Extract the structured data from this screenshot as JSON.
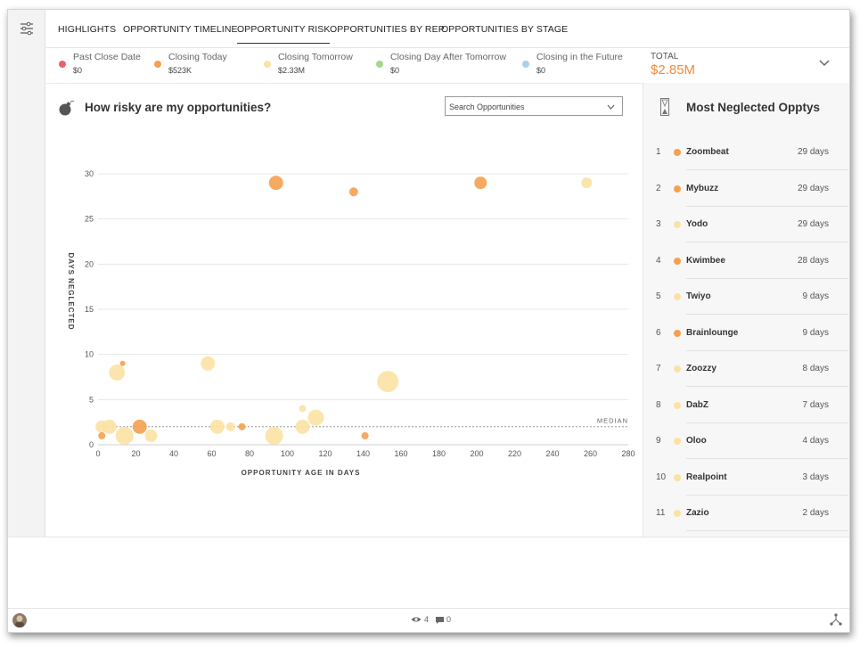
{
  "tabs": [
    "HIGHLIGHTS",
    "OPPORTUNITY TIMELINE",
    "OPPORTUNITY RISK",
    "OPPORTUNITIES BY REP",
    "OPPORTUNITIES BY STAGE"
  ],
  "active_tab": "OPPORTUNITY RISK",
  "legend": [
    {
      "label": "Past Close Date",
      "value": "$0",
      "color": "#e8626b"
    },
    {
      "label": "Closing Today",
      "value": "$523K",
      "color": "#f5a04f"
    },
    {
      "label": "Closing Tomorrow",
      "value": "$2.33M",
      "color": "#fbe2a4"
    },
    {
      "label": "Closing Day After Tomorrow",
      "value": "$0",
      "color": "#a4d88d"
    },
    {
      "label": "Closing in the Future",
      "value": "$0",
      "color": "#a8d0ef"
    }
  ],
  "total": {
    "label": "TOTAL",
    "value": "$2.85M"
  },
  "chart_title": "How risky are my opportunities?",
  "search": {
    "placeholder": "Search Opportunities"
  },
  "chart_data": {
    "type": "scatter",
    "xlabel": "OPPORTUNITY AGE IN DAYS",
    "ylabel": "DAYS NEGLECTED",
    "xlim": [
      0,
      280
    ],
    "ylim": [
      0,
      30
    ],
    "xticks": [
      "0",
      "20",
      "40",
      "60",
      "80",
      "100",
      "120",
      "140",
      "160",
      "180",
      "200",
      "220",
      "240",
      "260",
      "280"
    ],
    "yticks": [
      "0",
      "5",
      "10",
      "15",
      "20",
      "25",
      "30"
    ],
    "median": {
      "label": "MEDIAN",
      "y": 2
    },
    "grid": "horizontal",
    "points": [
      {
        "x": 94,
        "y": 29,
        "r": 8,
        "color": "#f5a04f"
      },
      {
        "x": 135,
        "y": 28,
        "r": 5,
        "color": "#f5a04f"
      },
      {
        "x": 202,
        "y": 29,
        "r": 7,
        "color": "#f5a04f"
      },
      {
        "x": 258,
        "y": 29,
        "r": 6,
        "color": "#fbe2a4"
      },
      {
        "x": 13,
        "y": 9,
        "r": 3,
        "color": "#f5a04f"
      },
      {
        "x": 10,
        "y": 8,
        "r": 9,
        "color": "#fbe2a4"
      },
      {
        "x": 58,
        "y": 9,
        "r": 8,
        "color": "#fbe2a4"
      },
      {
        "x": 153,
        "y": 7,
        "r": 12,
        "color": "#fbe2a4"
      },
      {
        "x": 2,
        "y": 2,
        "r": 7,
        "color": "#fbe2a4"
      },
      {
        "x": 6,
        "y": 2,
        "r": 8,
        "color": "#fbe2a4"
      },
      {
        "x": 2,
        "y": 1,
        "r": 4,
        "color": "#f5a04f"
      },
      {
        "x": 14,
        "y": 1,
        "r": 10,
        "color": "#fbe2a4"
      },
      {
        "x": 22,
        "y": 2,
        "r": 8,
        "color": "#f5a04f"
      },
      {
        "x": 28,
        "y": 1,
        "r": 7,
        "color": "#fbe2a4"
      },
      {
        "x": 63,
        "y": 2,
        "r": 8,
        "color": "#fbe2a4"
      },
      {
        "x": 70,
        "y": 2,
        "r": 5,
        "color": "#fbe2a4"
      },
      {
        "x": 76,
        "y": 2,
        "r": 4,
        "color": "#f5a04f"
      },
      {
        "x": 93,
        "y": 1,
        "r": 10,
        "color": "#fbe2a4"
      },
      {
        "x": 108,
        "y": 4,
        "r": 4,
        "color": "#fbe2a4"
      },
      {
        "x": 108,
        "y": 2,
        "r": 8,
        "color": "#fbe2a4"
      },
      {
        "x": 115,
        "y": 3,
        "r": 9,
        "color": "#fbe2a4"
      },
      {
        "x": 141,
        "y": 1,
        "r": 4,
        "color": "#f5a04f"
      }
    ]
  },
  "side": {
    "title": "Most Neglected Opptys",
    "items": [
      {
        "rank": "1",
        "name": "Zoombeat",
        "days": "29 days",
        "color": "#f5a04f"
      },
      {
        "rank": "2",
        "name": "Mybuzz",
        "days": "29 days",
        "color": "#f5a04f"
      },
      {
        "rank": "3",
        "name": "Yodo",
        "days": "29 days",
        "color": "#fbe2a4"
      },
      {
        "rank": "4",
        "name": "Kwimbee",
        "days": "28 days",
        "color": "#f5a04f"
      },
      {
        "rank": "5",
        "name": "Twiyo",
        "days": "9 days",
        "color": "#fbe2a4"
      },
      {
        "rank": "6",
        "name": "Brainlounge",
        "days": "9 days",
        "color": "#f5a04f"
      },
      {
        "rank": "7",
        "name": "Zoozzy",
        "days": "8 days",
        "color": "#fbe2a4"
      },
      {
        "rank": "8",
        "name": "DabZ",
        "days": "7 days",
        "color": "#fbe2a4"
      },
      {
        "rank": "9",
        "name": "Oloo",
        "days": "4 days",
        "color": "#fbe2a4"
      },
      {
        "rank": "10",
        "name": "Realpoint",
        "days": "3 days",
        "color": "#fbe2a4"
      },
      {
        "rank": "11",
        "name": "Zazio",
        "days": "2 days",
        "color": "#fbe2a4"
      }
    ]
  },
  "footer": {
    "views": "4",
    "comments": "0"
  }
}
